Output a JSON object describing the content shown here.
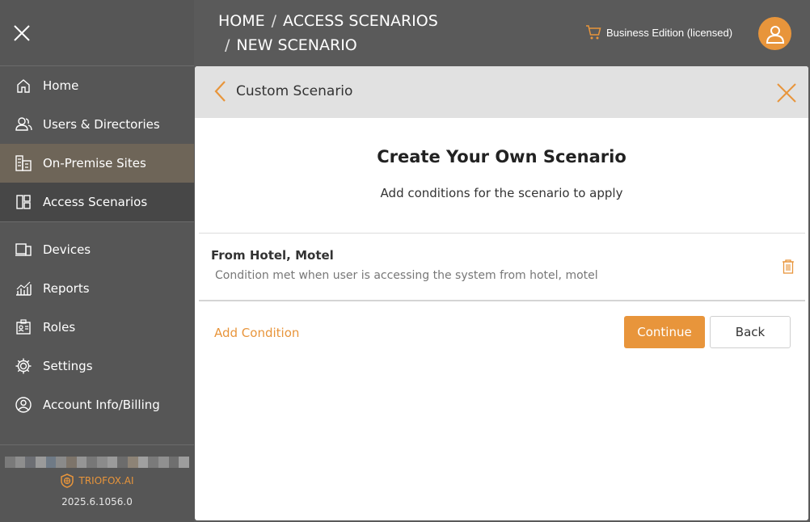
{
  "sidebar": {
    "items": [
      {
        "label": "Home",
        "icon": "home-icon"
      },
      {
        "label": "Users & Directories",
        "icon": "users-icon"
      },
      {
        "label": "On-Premise Sites",
        "icon": "building-icon"
      },
      {
        "label": "Access Scenarios",
        "icon": "layout-icon"
      },
      {
        "label": "Devices",
        "icon": "devices-icon"
      },
      {
        "label": "Reports",
        "icon": "chart-icon"
      },
      {
        "label": "Roles",
        "icon": "id-card-icon"
      },
      {
        "label": "Settings",
        "icon": "gear-icon"
      },
      {
        "label": "Account Info/Billing",
        "icon": "account-icon"
      }
    ],
    "brand": "TRIOFOX.AI",
    "version": "2025.6.1056.0"
  },
  "header": {
    "crumbs": [
      "HOME",
      "ACCESS SCENARIOS",
      "NEW SCENARIO"
    ],
    "separator": "/",
    "edition": "Business Edition (licensed)"
  },
  "panel": {
    "title": "Custom Scenario",
    "heading": "Create Your Own Scenario",
    "subheading": "Add conditions for the scenario to apply",
    "condition": {
      "title": "From Hotel, Motel",
      "description": "Condition met when user is accessing the system from hotel, motel"
    },
    "add_condition": "Add Condition",
    "continue_label": "Continue",
    "back_label": "Back"
  },
  "colors": {
    "accent": "#e8953b",
    "sidebar_bg": "#565656",
    "selected_site": "#6e6558",
    "selected_scenario": "#474747"
  }
}
